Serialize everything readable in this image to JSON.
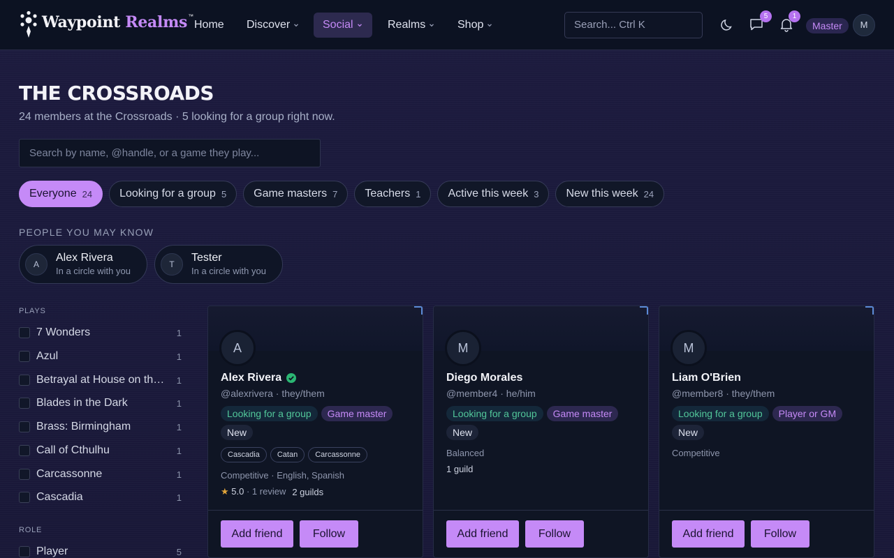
{
  "nav": {
    "logo_word1": "Waypoint",
    "logo_word2": "Realms",
    "logo_tm": "™",
    "links": [
      {
        "label": "Home",
        "dropdown": false
      },
      {
        "label": "Discover",
        "dropdown": true
      },
      {
        "label": "Social",
        "dropdown": true,
        "active": true
      },
      {
        "label": "Realms",
        "dropdown": true
      },
      {
        "label": "Shop",
        "dropdown": true
      }
    ],
    "search_placeholder": "Search... Ctrl K",
    "messages_count": "5",
    "notifications_count": "1",
    "role_pill": "Master",
    "avatar_initial": "M"
  },
  "page": {
    "title": "THE CROSSROADS",
    "subtitle": "24 members at the Crossroads · 5 looking for a group right now.",
    "search_placeholder": "Search by name, @handle, or a game they play..."
  },
  "chips": [
    {
      "label": "Everyone",
      "count": "24",
      "active": true
    },
    {
      "label": "Looking for a group",
      "count": "5"
    },
    {
      "label": "Game masters",
      "count": "7"
    },
    {
      "label": "Teachers",
      "count": "1"
    },
    {
      "label": "Active this week",
      "count": "3"
    },
    {
      "label": "New this week",
      "count": "24"
    }
  ],
  "pymk": {
    "label": "PEOPLE YOU MAY KNOW",
    "people": [
      {
        "initial": "A",
        "name": "Alex Rivera",
        "sub": "In a circle with you"
      },
      {
        "initial": "T",
        "name": "Tester",
        "sub": "In a circle with you"
      }
    ]
  },
  "filters": {
    "plays_label": "PLAYS",
    "plays": [
      {
        "label": "7 Wonders",
        "count": "1"
      },
      {
        "label": "Azul",
        "count": "1"
      },
      {
        "label": "Betrayal at House on the Hill",
        "count": "1"
      },
      {
        "label": "Blades in the Dark",
        "count": "1"
      },
      {
        "label": "Brass: Birmingham",
        "count": "1"
      },
      {
        "label": "Call of Cthulhu",
        "count": "1"
      },
      {
        "label": "Carcassonne",
        "count": "1"
      },
      {
        "label": "Cascadia",
        "count": "1"
      }
    ],
    "role_label": "ROLE",
    "roles": [
      {
        "label": "Player",
        "count": "5"
      }
    ]
  },
  "members": [
    {
      "initial": "A",
      "name": "Alex Rivera",
      "verified": true,
      "handle": "@alexrivera · they/them",
      "tags": [
        "Looking for a group",
        "Game master",
        "New"
      ],
      "games": [
        "Cascadia",
        "Catan",
        "Carcassonne"
      ],
      "style": "Competitive · English, Spanish",
      "rating_star": "★",
      "rating": "5.0",
      "reviews": "· 1 review",
      "guilds": "2 guilds",
      "add_label": "Add friend",
      "follow_label": "Follow"
    },
    {
      "initial": "M",
      "name": "Diego Morales",
      "verified": false,
      "handle": "@member4 · he/him",
      "tags": [
        "Looking for a group",
        "Game master",
        "New"
      ],
      "games": [],
      "style": "Balanced",
      "guilds": "1 guild",
      "add_label": "Add friend",
      "follow_label": "Follow"
    },
    {
      "initial": "M",
      "name": "Liam O'Brien",
      "verified": false,
      "handle": "@member8 · they/them",
      "tags": [
        "Looking for a group",
        "Player or GM",
        "New"
      ],
      "games": [],
      "style": "Competitive",
      "add_label": "Add friend",
      "follow_label": "Follow"
    }
  ],
  "colors": {
    "accent": "#c58af7",
    "lfg_green": "#52c79a",
    "verified_green": "#2bb673",
    "star": "#e0a43a"
  }
}
